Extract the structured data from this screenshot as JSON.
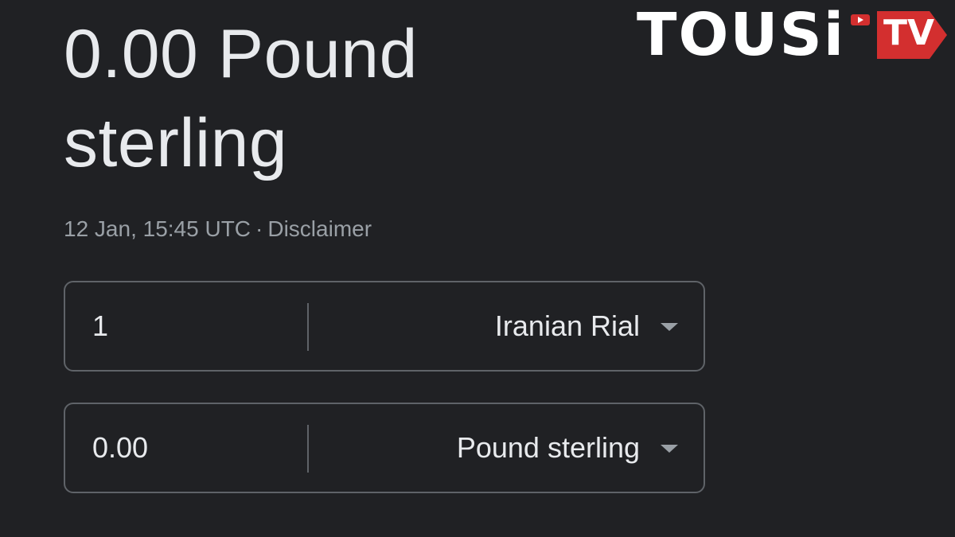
{
  "result": {
    "line1": "0.00 Pound",
    "line2": "sterling"
  },
  "meta": {
    "timestamp": "12 Jan, 15:45 UTC",
    "separator": "·",
    "disclaimer": "Disclaimer"
  },
  "converter": {
    "from": {
      "amount": "1",
      "currency": "Iranian Rial"
    },
    "to": {
      "amount": "0.00",
      "currency": "Pound sterling"
    }
  },
  "logo": {
    "text": "TOUSi",
    "badge": "TV",
    "brand_color": "#d32f2f"
  },
  "colors": {
    "background": "#202124",
    "text_primary": "#e8eaed",
    "text_secondary": "#9aa0a6",
    "border": "#5f6368"
  },
  "icons": [
    "chevron-down-icon",
    "play-icon"
  ]
}
